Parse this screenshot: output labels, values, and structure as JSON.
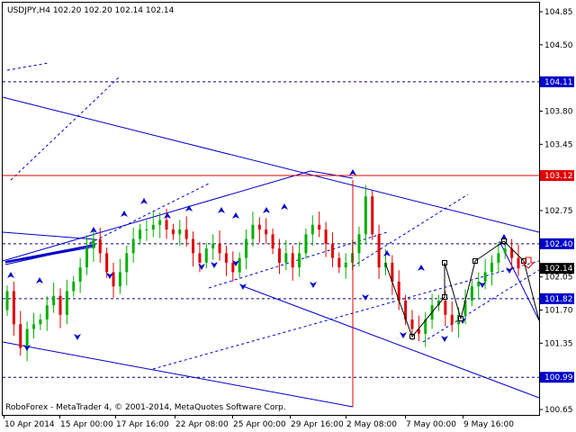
{
  "chart_data": {
    "type": "candlestick",
    "symbol_header": "USDJPY,H4  102.20 102.20 102.14 102.14",
    "copyright": "RoboForex - MetaTrader 4, © 2001-2014, MetaQuotes Software Corp.",
    "ylim": [
      100.55,
      104.9
    ],
    "y_ticks": [
      "104.85",
      "104.50",
      "103.80",
      "103.45",
      "102.75",
      "102.05",
      "101.70",
      "101.35",
      "100.65"
    ],
    "x_ticks": [
      "10 Apr 2014",
      "15 Apr 00:00",
      "17 Apr 16:00",
      "22 Apr 08:00",
      "25 Apr 00:00",
      "29 Apr 16:00",
      "2 May 08:00",
      "7 May 00:00",
      "9 May 16:00"
    ],
    "price_tags": [
      {
        "label": "104.11",
        "value": 104.11,
        "color": "#0000c8"
      },
      {
        "label": "103.12",
        "value": 103.12,
        "color": "#e00000"
      },
      {
        "label": "102.40",
        "value": 102.4,
        "color": "#0000c8"
      },
      {
        "label": "102.14",
        "value": 102.14,
        "color": "#000000"
      },
      {
        "label": "101.82",
        "value": 101.82,
        "color": "#0000c8"
      },
      {
        "label": "100.99",
        "value": 100.99,
        "color": "#0000c8"
      }
    ],
    "closes": [
      101.9,
      101.55,
      101.3,
      101.5,
      101.55,
      101.6,
      101.75,
      101.85,
      101.65,
      101.9,
      102.0,
      102.15,
      102.35,
      102.45,
      102.3,
      102.1,
      101.95,
      102.1,
      102.3,
      102.45,
      102.55,
      102.55,
      102.6,
      102.65,
      102.55,
      102.5,
      102.55,
      102.45,
      102.3,
      102.2,
      102.35,
      102.4,
      102.3,
      102.2,
      102.1,
      102.25,
      102.45,
      102.6,
      102.55,
      102.5,
      102.35,
      102.2,
      102.3,
      102.15,
      102.3,
      102.5,
      102.6,
      102.55,
      102.4,
      102.25,
      102.15,
      102.2,
      102.3,
      102.5,
      102.9,
      102.5,
      102.15,
      102.2,
      102.0,
      101.8,
      101.6,
      101.5,
      101.45,
      101.6,
      101.75,
      101.8,
      101.65,
      101.55,
      101.65,
      101.8,
      101.95,
      102.0,
      102.1,
      102.2,
      102.3,
      102.35,
      102.25,
      102.14
    ],
    "colors": {
      "up": "#00b000",
      "down": "#e00000",
      "trend": "#0000c8"
    }
  }
}
